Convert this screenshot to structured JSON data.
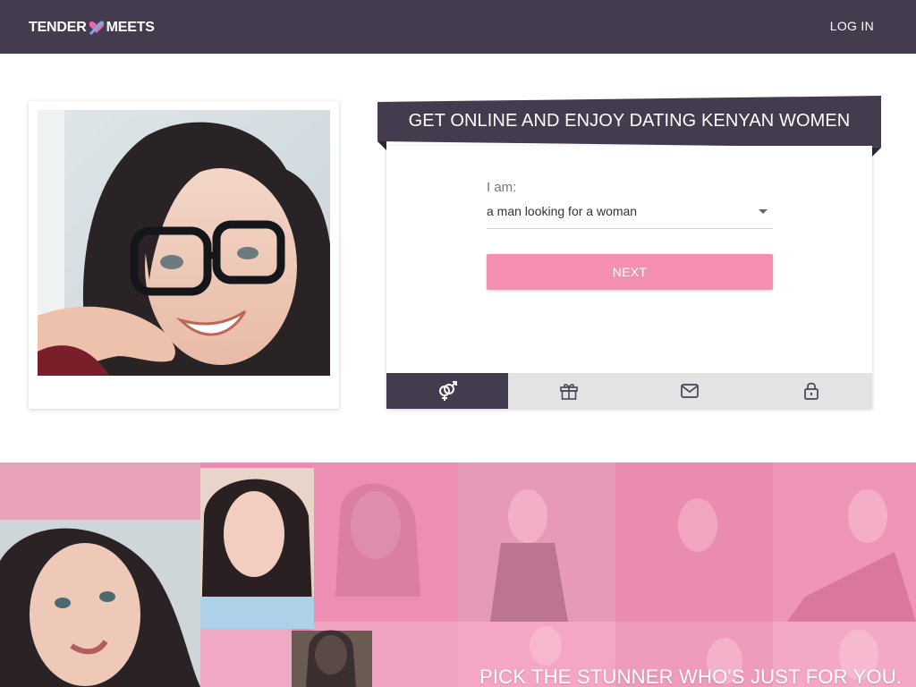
{
  "header": {
    "brand_left": "TENDER",
    "brand_right": "MEETS",
    "login_label": "LOG IN"
  },
  "hero": {
    "photo_icon": "woman-with-glasses-photo"
  },
  "form": {
    "title": "GET ONLINE AND ENJOY DATING KENYAN WOMEN",
    "field_label": "I am:",
    "select_value": "a man looking for a woman",
    "next_label": "NEXT",
    "steps": [
      {
        "icon": "gender-icon",
        "active": true
      },
      {
        "icon": "gift-icon",
        "active": false
      },
      {
        "icon": "mail-icon",
        "active": false
      },
      {
        "icon": "lock-icon",
        "active": false
      }
    ]
  },
  "collage": {
    "tagline": "PICK THE STUNNER WHO'S JUST FOR YOU."
  },
  "colors": {
    "header_bg": "#453b4f",
    "accent_pink": "#f48fb1",
    "step_inactive": "#e3e3e3",
    "collage_pink": "#f08ab0"
  }
}
